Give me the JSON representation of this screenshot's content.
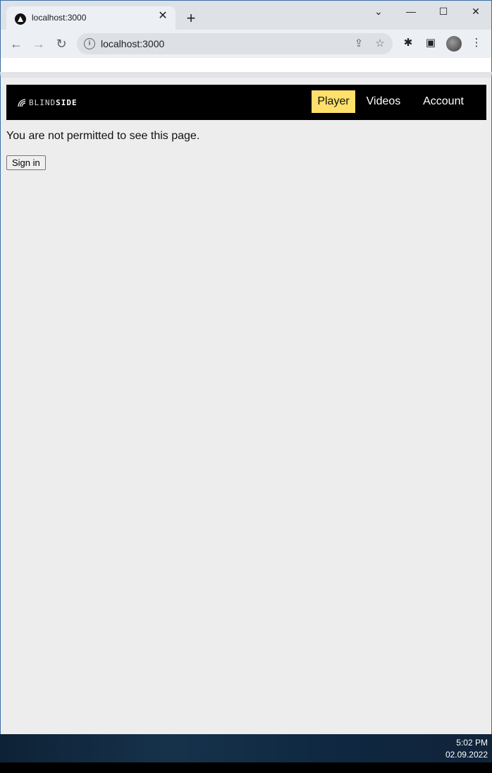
{
  "browser": {
    "tab_title": "localhost:3000",
    "url": "localhost:3000"
  },
  "site": {
    "logo_light": "BLIND",
    "logo_bold": "SIDE",
    "nav": [
      {
        "label": "Player",
        "active": true
      },
      {
        "label": "Videos",
        "active": false
      },
      {
        "label": "Account",
        "active": false
      }
    ]
  },
  "main": {
    "message": "You are not permitted to see this page.",
    "signin_label": "Sign in"
  },
  "taskbar": {
    "time": "5:02 PM",
    "date": "02.09.2022"
  },
  "colors": {
    "nav_bg": "#000000",
    "nav_active": "#ffe06b",
    "page_bg": "#ededed"
  }
}
